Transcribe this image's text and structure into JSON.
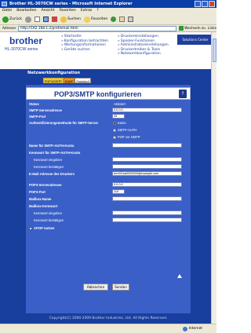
{
  "window": {
    "title": "Brother HL-3070CW series - Microsoft Internet Explorer"
  },
  "menu": [
    "Datei",
    "Bearbeiten",
    "Ansicht",
    "Favoriten",
    "Extras",
    "?"
  ],
  "toolbar": {
    "back": "Zurück",
    "search": "Suchen",
    "favorites": "Favoriten"
  },
  "address": {
    "label": "Adresse",
    "value": "http://192.168.1.2/pref/email.html",
    "go": "Wechseln zu",
    "links": "Links"
  },
  "header": {
    "logo": "brother",
    "model": "HL-3070CW series",
    "nav_left": [
      "Startseite",
      "Konfiguration betrachten",
      "Wartungsinformationen",
      "Geräte suchen"
    ],
    "nav_right": [
      "Druckereinstellungen",
      "Spooler-Funktionen",
      "Administratoreinstellungen",
      "Druckertreiber & Tools",
      "Netzwerkkonfiguration"
    ],
    "solutions": "Solutions Center"
  },
  "banner": {
    "title": "Netzwerkkonfiguration",
    "tabs": [
      "POP3/SMTP",
      "SNMP",
      "Protokoll"
    ]
  },
  "panel": {
    "title": "POP3/SMTP konfigurieren",
    "help": "?"
  },
  "form": {
    "status_label": "Status",
    "status_value": "Aktiviert",
    "smtp_server_label": "SMTP-Serveradresse",
    "smtp_server_value": "0.0.0.0",
    "smtp_port_label": "SMTP-Port",
    "smtp_port_value": "25",
    "auth_label": "Authentifizierungsmethode für SMTP-Server",
    "auth_options": [
      "Keine",
      "SMTP-AUTH",
      "POP vor SMTP"
    ],
    "smtp_auth_name_label": "Name für SMTP-AUTH-Konto",
    "smtp_auth_pw_label": "Kennwort für SMTP-AUTH-Konto",
    "pw_enter_label": "Kennwort eingeben",
    "pw_confirm_label": "Kennwort bestätigen",
    "email_label": "E-Mail-Adresse des Druckers",
    "email_value": "brn001ba0000000@example.com",
    "pop3_server_label": "POP3-Serveradresse",
    "pop3_server_value": "0.0.0.0",
    "pop3_port_label": "POP3-Port",
    "pop3_port_value": "110",
    "mailbox_name_label": "Mailbox-Name",
    "mailbox_pw_label": "Mailbox-Kennwort",
    "mailbox_pw_enter_label": "Kennwort eingeben",
    "mailbox_pw_confirm_label": "Kennwort bestätigen",
    "apop_label": "APOP nutzen"
  },
  "buttons": {
    "cancel": "Abbrechen",
    "send": "Senden"
  },
  "footer": {
    "copyright": "Copyright(C) 2000-2009 Brother Industries, Ltd. All Rights Reserved."
  },
  "status": {
    "zone": "Internet"
  }
}
